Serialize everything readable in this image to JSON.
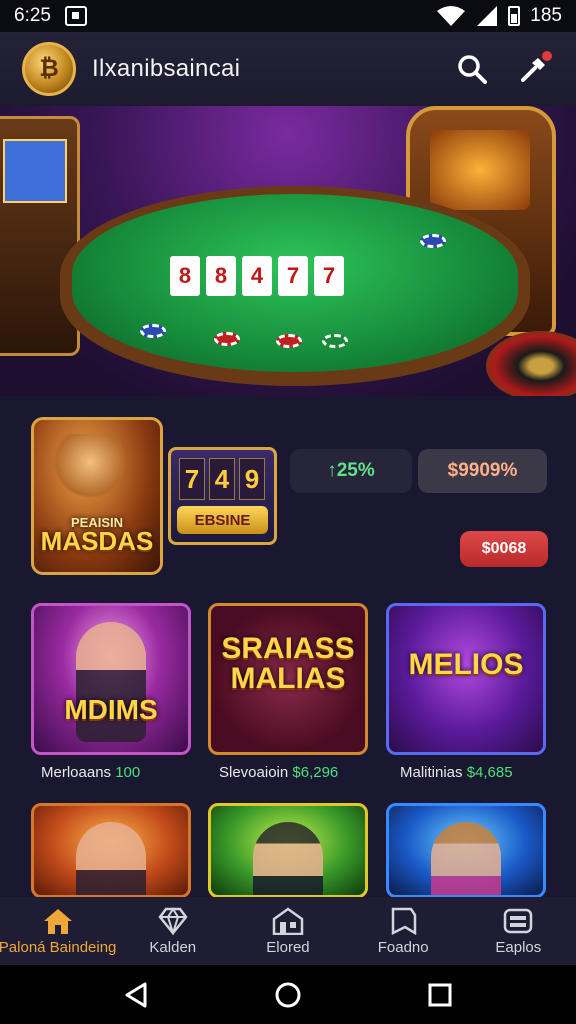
{
  "status_bar": {
    "time": "6:25",
    "battery": "185"
  },
  "header": {
    "title": "Ilxanibsaincai",
    "logo_glyph": "₿"
  },
  "hero": {
    "cards": [
      "8",
      "8",
      "4",
      "7",
      "7"
    ]
  },
  "featured": {
    "tile_label_top": "PEAISIN",
    "tile_label": "MASDAS",
    "slot_reels": [
      "7",
      "4",
      "9"
    ],
    "slot_button": "EBSINE",
    "stat_green": "↑25%",
    "stat_red": "$9909%",
    "cta": "$0068"
  },
  "games": [
    {
      "art": "MDIMS",
      "name": "Merloaans",
      "amount": "100"
    },
    {
      "art": "SRAIASS MALIAS",
      "name": "Slevoaioin",
      "amount": "$6,296"
    },
    {
      "art": "MELIOS",
      "name": "Malitinias",
      "amount": "$4,685"
    },
    {
      "art": "",
      "name": "",
      "amount": ""
    },
    {
      "art": "",
      "name": "",
      "amount": ""
    },
    {
      "art": "",
      "name": "",
      "amount": ""
    }
  ],
  "bottom_nav": [
    {
      "label": "Paloná Baindeing",
      "icon": "home-icon",
      "active": true
    },
    {
      "label": "Kalden",
      "icon": "diamond-icon",
      "active": false
    },
    {
      "label": "Elored",
      "icon": "store-icon",
      "active": false
    },
    {
      "label": "Foadno",
      "icon": "bookmark-icon",
      "active": false
    },
    {
      "label": "Eaplos",
      "icon": "wallet-icon",
      "active": false
    }
  ],
  "colors": {
    "accent": "#f0a73a",
    "green": "#4ee07a",
    "cta": "#d03a3a",
    "bg": "#1a1730"
  }
}
